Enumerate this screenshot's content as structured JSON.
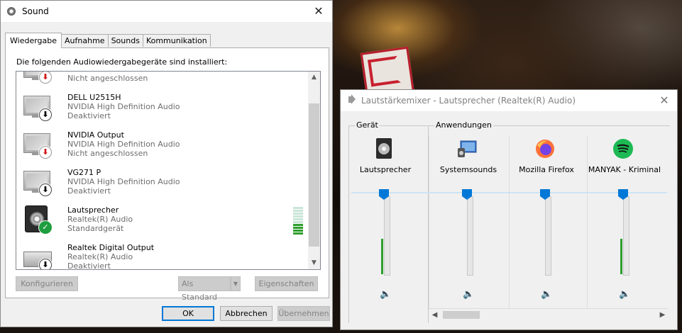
{
  "sound_window": {
    "title": "Sound",
    "tabs": [
      "Wiedergabe",
      "Aufnahme",
      "Sounds",
      "Kommunikation"
    ],
    "active_tab": "Wiedergabe",
    "caption": "Die folgenden Audiowiedergabegeräte sind installiert:",
    "devices": [
      {
        "name": "",
        "driver": "",
        "status": "Nicht angeschlossen",
        "icon": "monitor-icon",
        "badge": "disconnected-icon"
      },
      {
        "name": "DELL U2515H",
        "driver": "NVIDIA High Definition Audio",
        "status": "Deaktiviert",
        "icon": "monitor-icon",
        "badge": "disabled-icon"
      },
      {
        "name": "NVIDIA Output",
        "driver": "NVIDIA High Definition Audio",
        "status": "Nicht angeschlossen",
        "icon": "monitor-icon",
        "badge": "disconnected-icon"
      },
      {
        "name": "VG271 P",
        "driver": "NVIDIA High Definition Audio",
        "status": "Deaktiviert",
        "icon": "monitor-icon",
        "badge": "disabled-icon"
      },
      {
        "name": "Lautsprecher",
        "driver": "Realtek(R) Audio",
        "status": "Standardgerät",
        "icon": "speaker-icon",
        "badge": "default-check-icon"
      },
      {
        "name": "Realtek Digital Output",
        "driver": "Realtek(R) Audio",
        "status": "Deaktiviert",
        "icon": "digital-output-icon",
        "badge": "disabled-icon"
      }
    ],
    "level_meter": {
      "segments_total": 10,
      "segments_lit": 4,
      "lit_color": "#2e9e2e",
      "unlit_color": "#c9e6d8"
    },
    "buttons": {
      "configure": "Konfigurieren",
      "set_default": "Als Standard",
      "properties": "Eigenschaften",
      "ok": "OK",
      "cancel": "Abbrechen",
      "apply": "Übernehmen"
    }
  },
  "mixer_window": {
    "title": "Lautstärkemixer - Lautsprecher (Realtek(R) Audio)",
    "group_device": "Gerät",
    "group_apps": "Anwendungen",
    "channels": [
      {
        "name": "Lautsprecher",
        "icon": "speaker-icon",
        "volume": 1.0,
        "peak": 0.45
      },
      {
        "name": "Systemsounds",
        "icon": "system-sounds-icon",
        "volume": 1.0,
        "peak": 0
      },
      {
        "name": "Mozilla Firefox",
        "icon": "firefox-icon",
        "volume": 1.0,
        "peak": 0
      },
      {
        "name": "MANYAK - Kriminal",
        "icon": "spotify-icon",
        "volume": 1.0,
        "peak": 0.45
      }
    ],
    "accent_color": "#0078d7"
  }
}
